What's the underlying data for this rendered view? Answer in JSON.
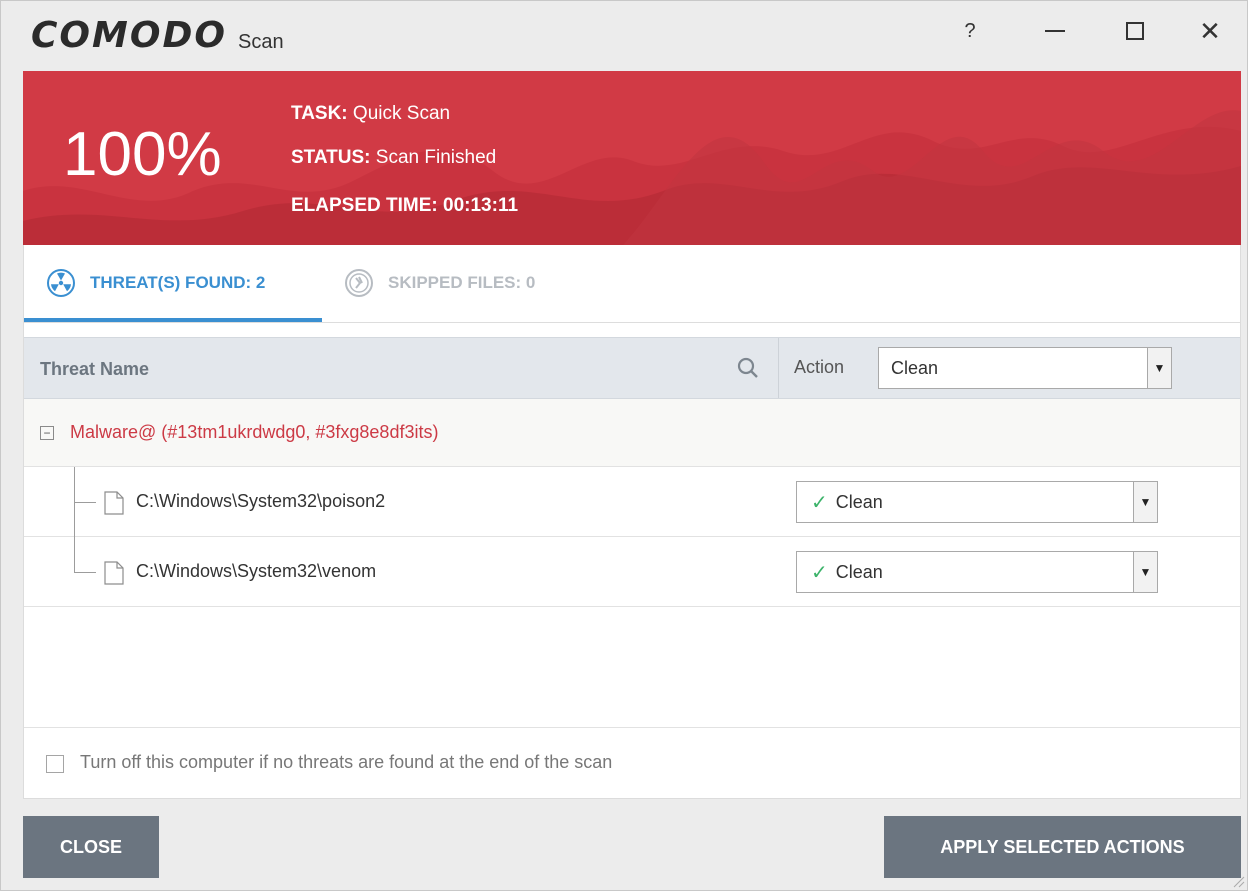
{
  "window": {
    "logo": "COMODO",
    "subtitle": "Scan",
    "help_label": "?"
  },
  "banner": {
    "percent": "100%",
    "task_label": "TASK:",
    "task_value": "Quick Scan",
    "status_label": "STATUS:",
    "status_value": "Scan Finished",
    "elapsed_label": "ELAPSED TIME:",
    "elapsed_value": "00:13:11",
    "color": "#d13a45"
  },
  "tabs": [
    {
      "label": "THREAT(S) FOUND: 2",
      "icon": "radiation-icon",
      "active": true
    },
    {
      "label": "SKIPPED FILES: 0",
      "icon": "skip-icon",
      "active": false
    }
  ],
  "table": {
    "col_threat": "Threat Name",
    "col_action": "Action",
    "action_value": "Clean",
    "group": {
      "label": "Malware@ (#13tm1ukrdwdg0, #3fxg8e8df3its)",
      "expander": "−"
    },
    "rows": [
      {
        "path": "C:\\Windows\\System32\\poison2",
        "action": "Clean"
      },
      {
        "path": "C:\\Windows\\System32\\venom",
        "action": "Clean"
      }
    ]
  },
  "option": {
    "label": "Turn off this computer if no threats are found at the end of the scan",
    "checked": false
  },
  "buttons": {
    "close": "CLOSE",
    "apply": "APPLY SELECTED ACTIONS"
  },
  "colors": {
    "accent": "#3a8fd1",
    "threat_text": "#cc3a45",
    "button_bg": "#6b7580",
    "check_green": "#3cb36a"
  }
}
